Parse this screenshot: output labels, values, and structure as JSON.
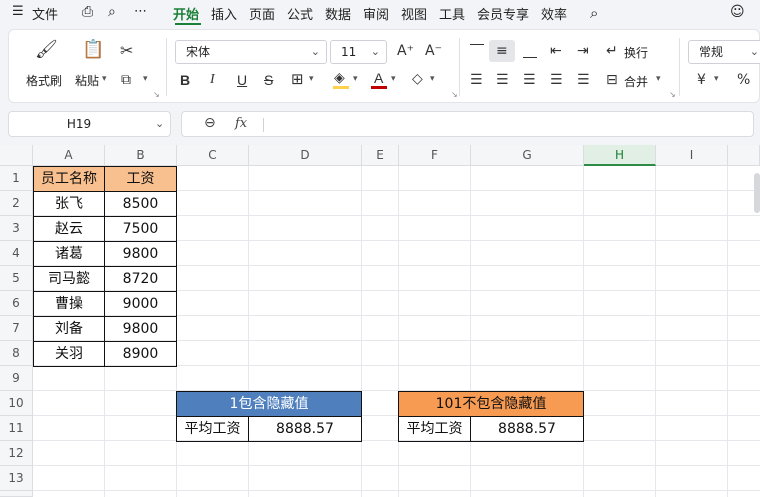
{
  "menubar": {
    "file": "文件",
    "tabs": [
      "开始",
      "插入",
      "页面",
      "公式",
      "数据",
      "审阅",
      "视图",
      "工具",
      "会员专享",
      "效率"
    ],
    "active_tab": "开始"
  },
  "ribbon": {
    "format_painter": "格式刷",
    "paste": "粘贴",
    "font_name": "宋体",
    "font_size": "11",
    "wrap": "换行",
    "merge": "合并",
    "number_format": "常规",
    "currency_symbol": "¥",
    "percent_symbol": "%",
    "bold": "B",
    "italic": "I",
    "underline": "U",
    "strike": "S",
    "font_color_letter": "A",
    "grow_font": "A⁺",
    "shrink_font": "A⁻",
    "font_color": "#c00000",
    "fill_color": "#ffd24d"
  },
  "formula_bar": {
    "name_box": "H19",
    "fx_label": "fx",
    "value": ""
  },
  "sheet": {
    "columns": [
      "A",
      "B",
      "C",
      "D",
      "E",
      "F",
      "G",
      "H",
      "I"
    ],
    "selected_column": "H",
    "rows": [
      "1",
      "2",
      "3",
      "4",
      "5",
      "6",
      "7",
      "8",
      "9",
      "10",
      "11",
      "12",
      "13"
    ],
    "table": {
      "header": [
        "员工名称",
        "工资"
      ],
      "rows": [
        [
          "张飞",
          "8500"
        ],
        [
          "赵云",
          "7500"
        ],
        [
          "诸葛",
          "9800"
        ],
        [
          "司马懿",
          "8720"
        ],
        [
          "曹操",
          "9000"
        ],
        [
          "刘备",
          "9800"
        ],
        [
          "关羽",
          "8900"
        ]
      ]
    },
    "box1": {
      "title": "1包含隐藏值",
      "label": "平均工资",
      "value": "8888.57"
    },
    "box2": {
      "title": "101不包含隐藏值",
      "label": "平均工资",
      "value": "8888.57"
    },
    "colors": {
      "header_fill": "#f8bf8f",
      "box1_fill": "#4f7fbd",
      "box2_fill": "#f79a52",
      "selection_green": "#1a7f37"
    }
  }
}
